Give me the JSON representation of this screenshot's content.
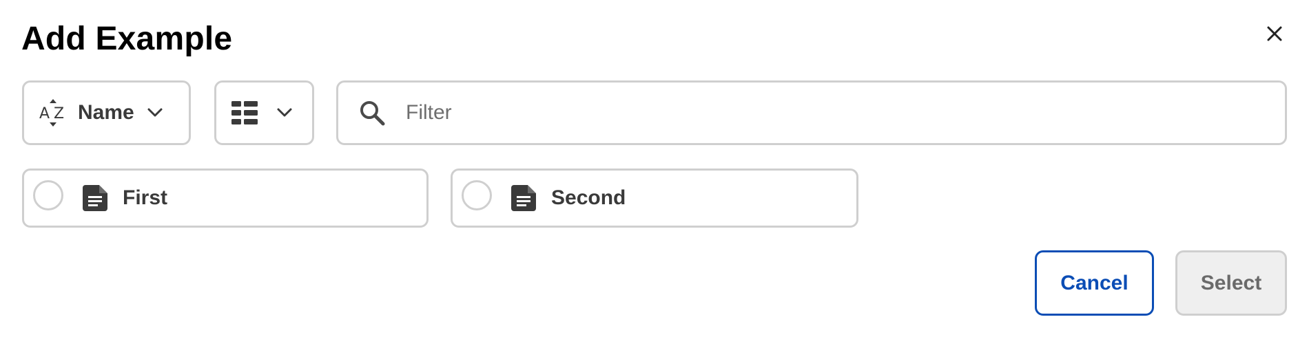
{
  "dialog": {
    "title": "Add Example",
    "close_icon": "close-icon"
  },
  "toolbar": {
    "sort": {
      "label": "Name",
      "icon": "sort-alpha-icon",
      "chevron": "chevron-down-icon"
    },
    "view": {
      "icon": "grid-view-icon",
      "chevron": "chevron-down-icon"
    },
    "filter": {
      "placeholder": "Filter",
      "value": "",
      "icon": "search-icon"
    }
  },
  "items": [
    {
      "label": "First",
      "icon": "document-icon",
      "selected": false
    },
    {
      "label": "Second",
      "icon": "document-icon",
      "selected": false
    }
  ],
  "footer": {
    "cancel_label": "Cancel",
    "select_label": "Select",
    "select_disabled": true
  },
  "colors": {
    "accent": "#0b4db5",
    "border": "#cfcfcf",
    "text": "#3a3a3a"
  }
}
